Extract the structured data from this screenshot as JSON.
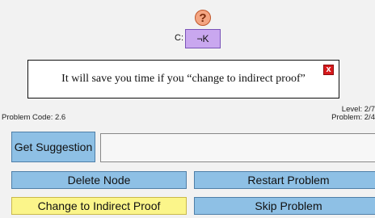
{
  "help_icon": "?",
  "node": {
    "prefix": "C:",
    "label": "¬K"
  },
  "hint": {
    "text": "It will save you time if you “change to indirect proof”",
    "close_glyph": "x"
  },
  "status": {
    "problem_code": "Problem Code: 2.6",
    "level": "Level: 2/7",
    "problem": "Problem: 2/4"
  },
  "buttons": {
    "get_suggestion": "Get Suggestion",
    "delete_node": "Delete Node",
    "restart_problem": "Restart Problem",
    "change_to_indirect": "Change to Indirect Proof",
    "skip_problem": "Skip Problem"
  },
  "suggestion_box": {
    "value": ""
  }
}
